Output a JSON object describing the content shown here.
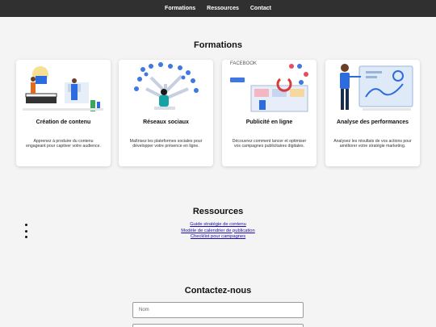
{
  "nav": {
    "items": [
      "Formations",
      "Ressources",
      "Contact"
    ]
  },
  "formations": {
    "title": "Formations",
    "cards": [
      {
        "title": "Création de contenu",
        "desc": "Apprenez à produire du contenu engageant pour captiver votre audience."
      },
      {
        "title": "Réseaux sociaux",
        "desc": "Maîtrisez les plateformes sociales pour développer votre présence en ligne."
      },
      {
        "title": "Publicité en ligne",
        "desc": "Découvrez comment lancer et optimiser vos campagnes publicitaires digitales."
      },
      {
        "title": "Analyse des performances",
        "desc": "Analysez les résultats de vos actions pour améliorer votre stratégie marketing."
      }
    ],
    "illustrations": {
      "card3_text": "FACEBOOK"
    }
  },
  "ressources": {
    "title": "Ressources",
    "links": [
      "Guide stratégie de contenu",
      "Modèle de calendrier de publication",
      "Checklist pour campagnes"
    ]
  },
  "contact": {
    "title": "Contactez-nous",
    "name_placeholder": "Nom"
  }
}
